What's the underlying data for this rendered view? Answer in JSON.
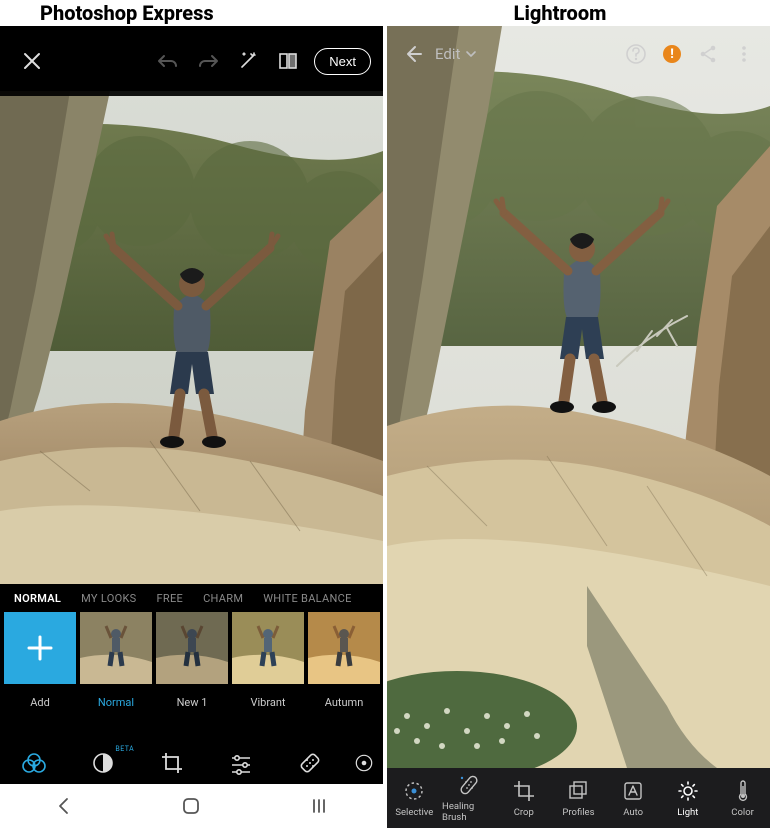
{
  "titles": {
    "left": "Photoshop Express",
    "right": "Lightroom"
  },
  "psx": {
    "next_button": "Next",
    "filter_tabs": [
      "NORMAL",
      "MY LOOKS",
      "FREE",
      "CHARM",
      "WHITE BALANCE"
    ],
    "selected_tab_index": 0,
    "thumbs": [
      {
        "label": "Add"
      },
      {
        "label": "Normal"
      },
      {
        "label": "New 1"
      },
      {
        "label": "Vibrant"
      },
      {
        "label": "Autumn"
      }
    ],
    "selected_thumb_index": 1,
    "beta_label": "BETA"
  },
  "lr": {
    "edit_label": "Edit",
    "tools": [
      {
        "label": "Selective"
      },
      {
        "label": "Healing Brush"
      },
      {
        "label": "Crop"
      },
      {
        "label": "Profiles"
      },
      {
        "label": "Auto"
      },
      {
        "label": "Light"
      },
      {
        "label": "Color"
      }
    ],
    "selected_tool_index": 5
  }
}
